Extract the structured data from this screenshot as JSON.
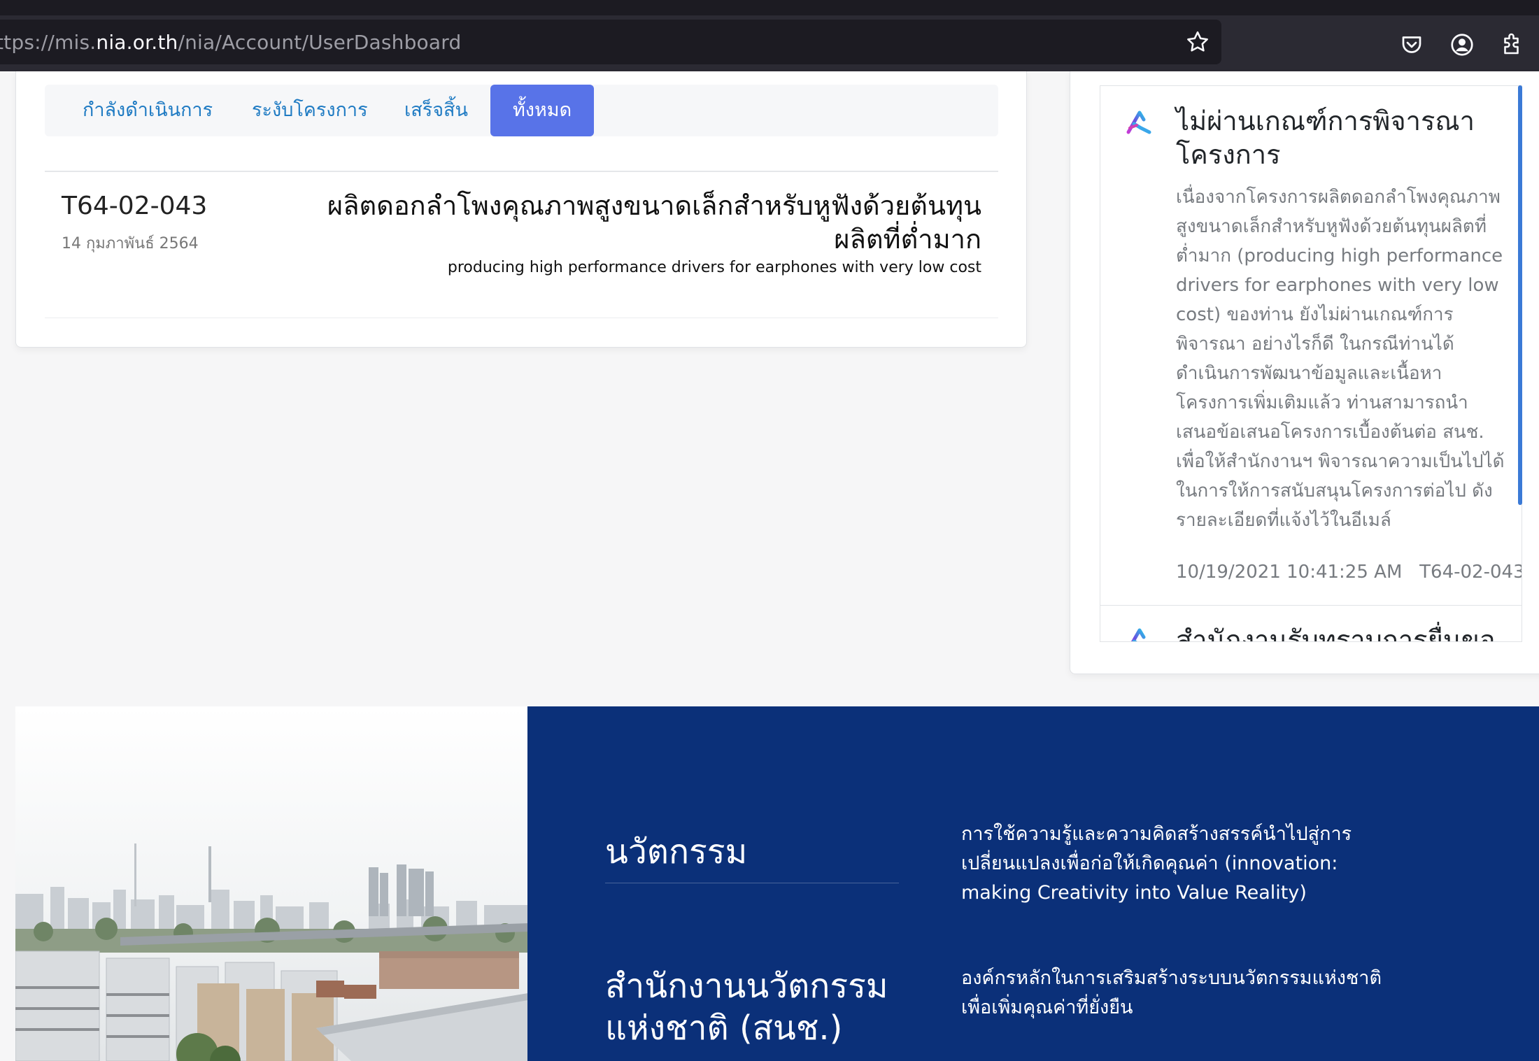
{
  "browser": {
    "url_prefix": "ttps://mis.",
    "url_host": "nia.or.th",
    "url_path": "/nia/Account/UserDashboard",
    "icons": [
      "bookmark-star-icon",
      "pocket-icon",
      "account-icon",
      "extensions-icon"
    ]
  },
  "tabs": [
    {
      "label": "กำลังดำเนินการ",
      "active": false
    },
    {
      "label": "ระงับโครงการ",
      "active": false
    },
    {
      "label": "เสร็จสิ้น",
      "active": false
    },
    {
      "label": "ทั้งหมด",
      "active": true
    }
  ],
  "project": {
    "code": "T64-02-043",
    "date": "14 กุมภาพันธ์ 2564",
    "title": "ผลิตดอกลำโพงคุณภาพสูงขนาดเล็กสำหรับหูฟังด้วยต้นทุนผลิตที่ต่ำมาก",
    "subtitle": "producing high performance drivers for earphones with very low cost"
  },
  "notifications": [
    {
      "title": "ไม่ผ่านเกณฑ์การพิจารณาโครงการ",
      "body": "เนื่องจากโครงการผลิตดอกลำโพงคุณภาพสูงขนาดเล็กสำหรับหูฟังด้วยต้นทุนผลิตที่ต่ำมาก (producing high performance drivers for earphones with very low cost) ของท่าน ยังไม่ผ่านเกณฑ์การพิจารณา อย่างไรก็ดี ในกรณีท่านได้ดำเนินการพัฒนาข้อมูลและเนื้อหาโครงการเพิ่มเติมแล้ว ท่านสามารถนำเสนอข้อเสนอโครงการเบื้องต้นต่อ สนช. เพื่อให้สำนักงานฯ พิจารณาความเป็นไปได้ในการให้การสนับสนุนโครงการต่อไป ดังรายละเอียดที่แจ้งไว้ในอีเมล์",
      "timestamp": "10/19/2021 10:41:25 AM",
      "code": "T64-02-043"
    },
    {
      "title": "สำนักงานรับทราบการยื่นขอ"
    }
  ],
  "footer": {
    "heading1": "นวัตกรรม",
    "desc1": "การใช้ความรู้และความคิดสร้างสรรค์นำไปสู่การเปลี่ยนแปลงเพื่อก่อให้เกิดคุณค่า (innovation: making Creativity into Value Reality)",
    "heading2": "สำนักงานนวัตกรรมแห่งชาติ (สนช.)",
    "desc2": "องค์กรหลักในการเสริมสร้างระบบนวัตกรรมแห่งชาติเพื่อเพิ่มคุณค่าที่ยั่งยืน"
  },
  "colors": {
    "tab_text": "#1f7bc3",
    "tab_active_bg": "#5873e8",
    "footer_bg": "#0b3079",
    "scrollbar": "#3b7ad6"
  }
}
